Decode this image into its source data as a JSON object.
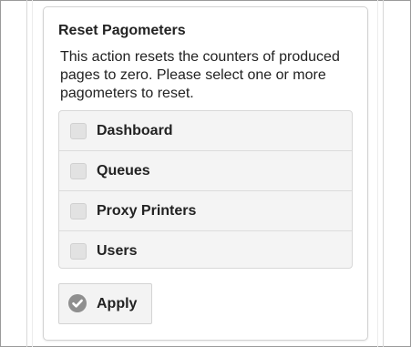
{
  "panel": {
    "title": "Reset Pagometers",
    "description": "This action resets the counters of produced pages to zero. Please select one or more pagometers to reset."
  },
  "pagometers": [
    {
      "label": "Dashboard",
      "checked": false
    },
    {
      "label": "Queues",
      "checked": false
    },
    {
      "label": "Proxy Printers",
      "checked": false
    },
    {
      "label": "Users",
      "checked": false
    }
  ],
  "apply_button": {
    "label": "Apply",
    "icon": "check-circle-icon"
  }
}
